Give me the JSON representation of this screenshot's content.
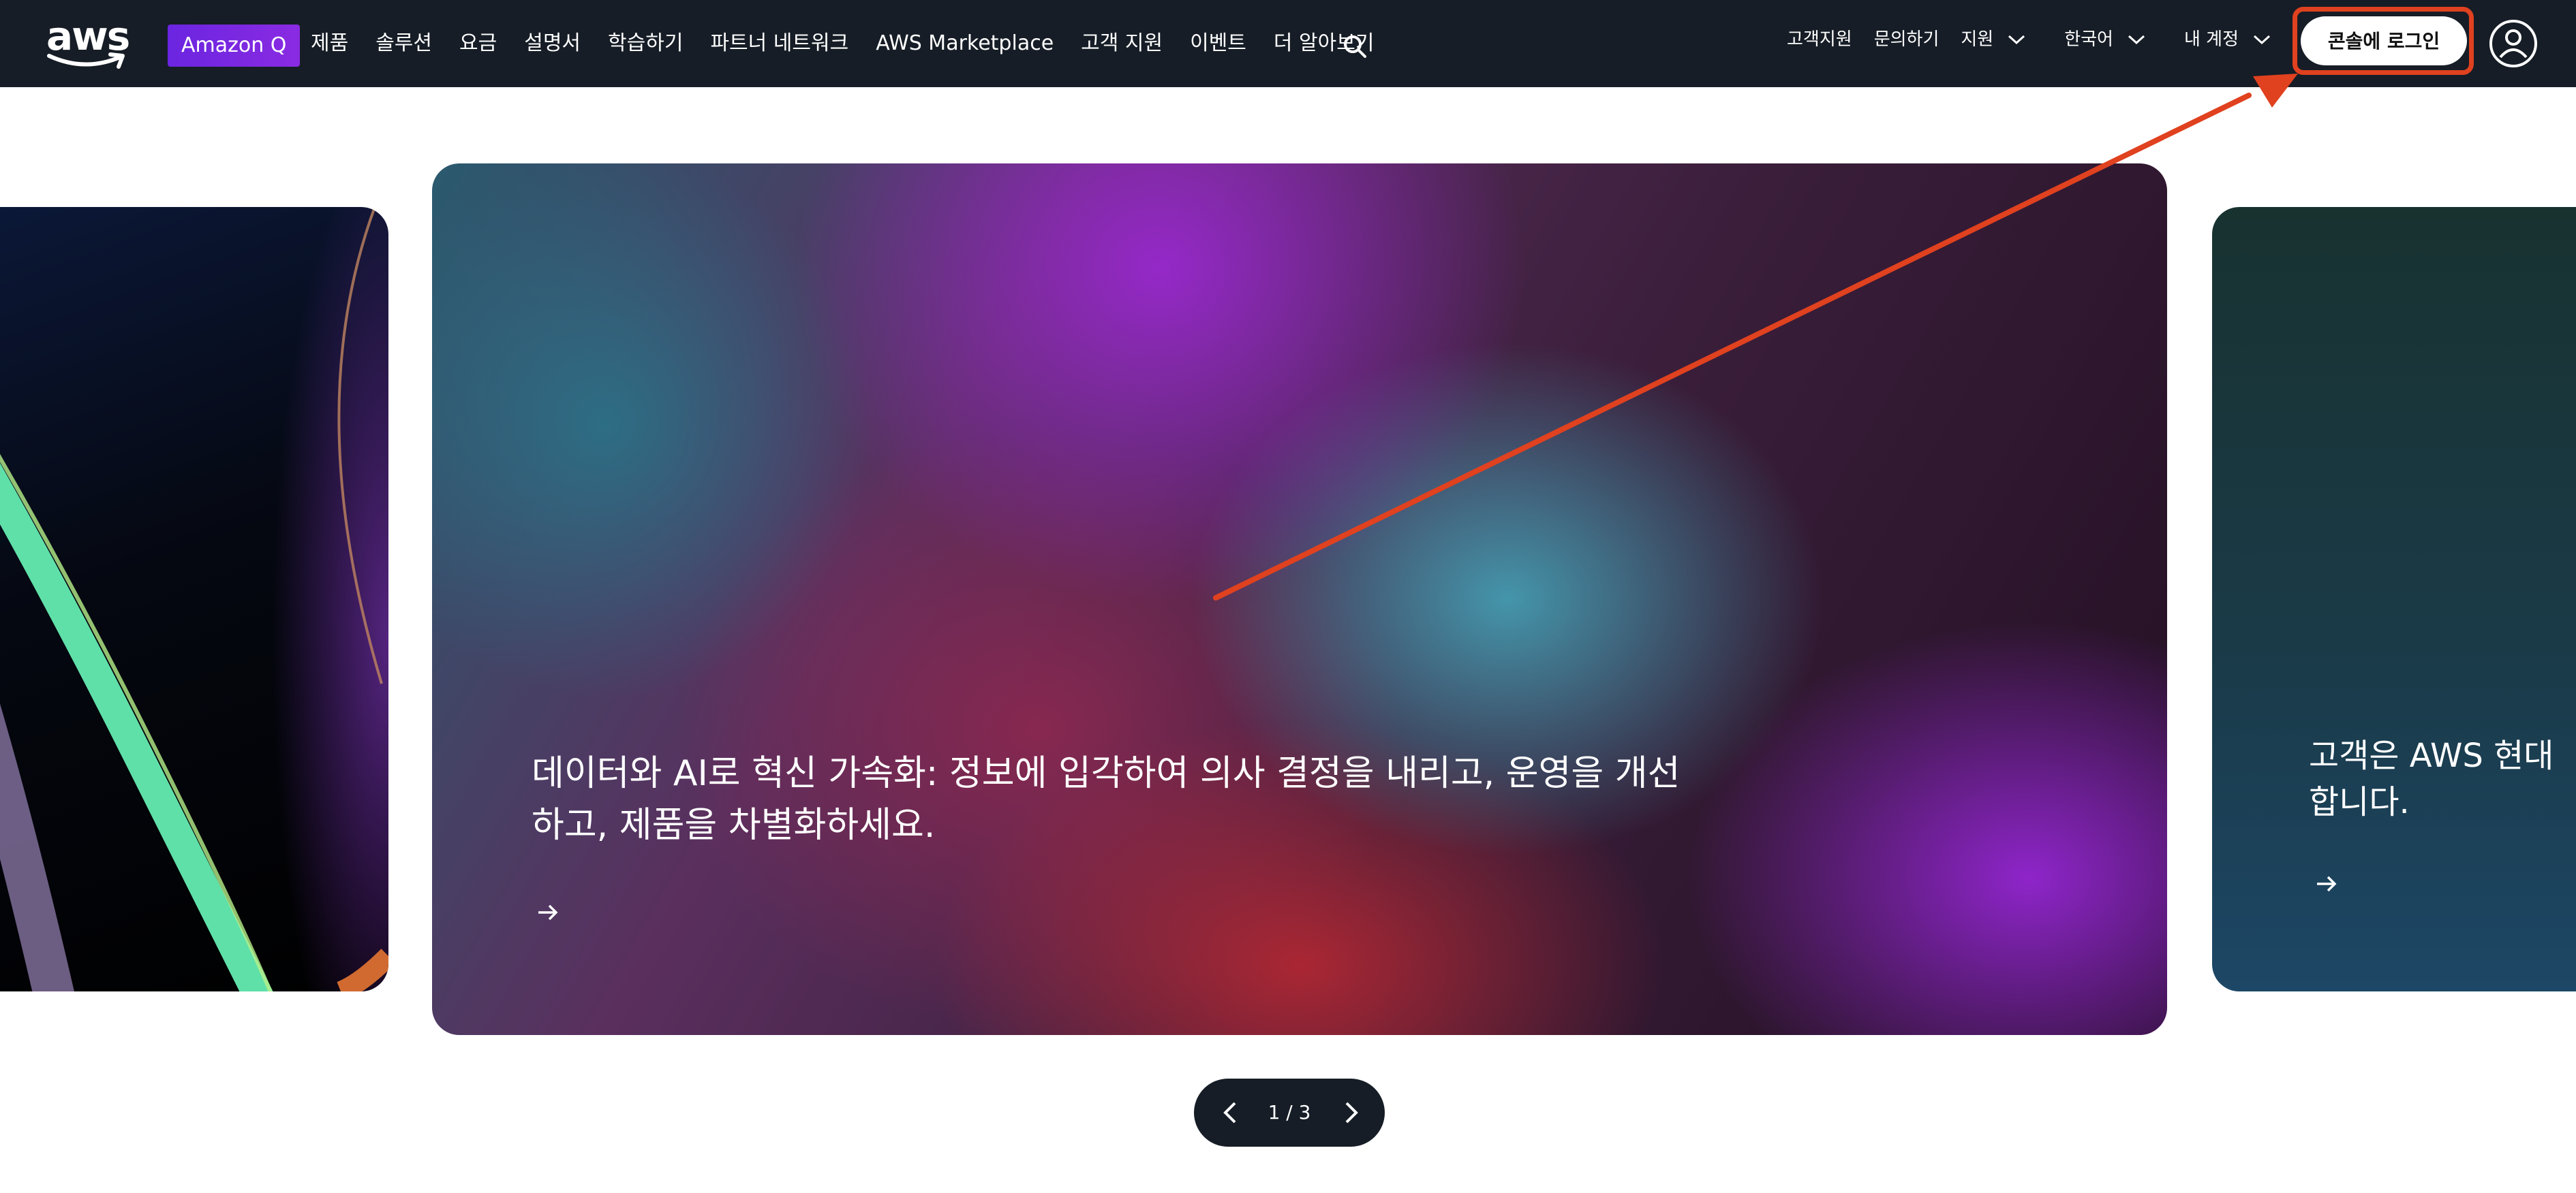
{
  "brand": {
    "logo_text": "aws",
    "amazon_q": "Amazon Q"
  },
  "nav": {
    "main_items": [
      "제품",
      "솔루션",
      "요금",
      "설명서",
      "학습하기",
      "파트너 네트워크",
      "AWS Marketplace",
      "고객 지원",
      "이벤트",
      "더 알아보기"
    ],
    "search_icon": "search-icon",
    "right_items": {
      "customer_support": "고객지원",
      "contact": "문의하기",
      "support": "지원",
      "language": "한국어",
      "my_account": "내 계정"
    },
    "login_button": "콘솔에 로그인",
    "user_icon": "user-icon"
  },
  "carousel": {
    "center_headline": "데이터와 AI로 혁신 가속화: 정보에 입각하여 의사 결정을 내리고, 운영을 개선하고, 제품을 차별화하세요.",
    "right_headline_line1": "고객은 AWS 현대",
    "right_headline_line2": "합니다.",
    "arrow_icon": "arrow-right-icon",
    "pager": {
      "current": "1",
      "total": "3",
      "label": "1 / 3"
    }
  },
  "colors": {
    "nav_bg": "#161d26",
    "amazon_q": "#7b2fe6",
    "annotation": "#e0411f"
  }
}
